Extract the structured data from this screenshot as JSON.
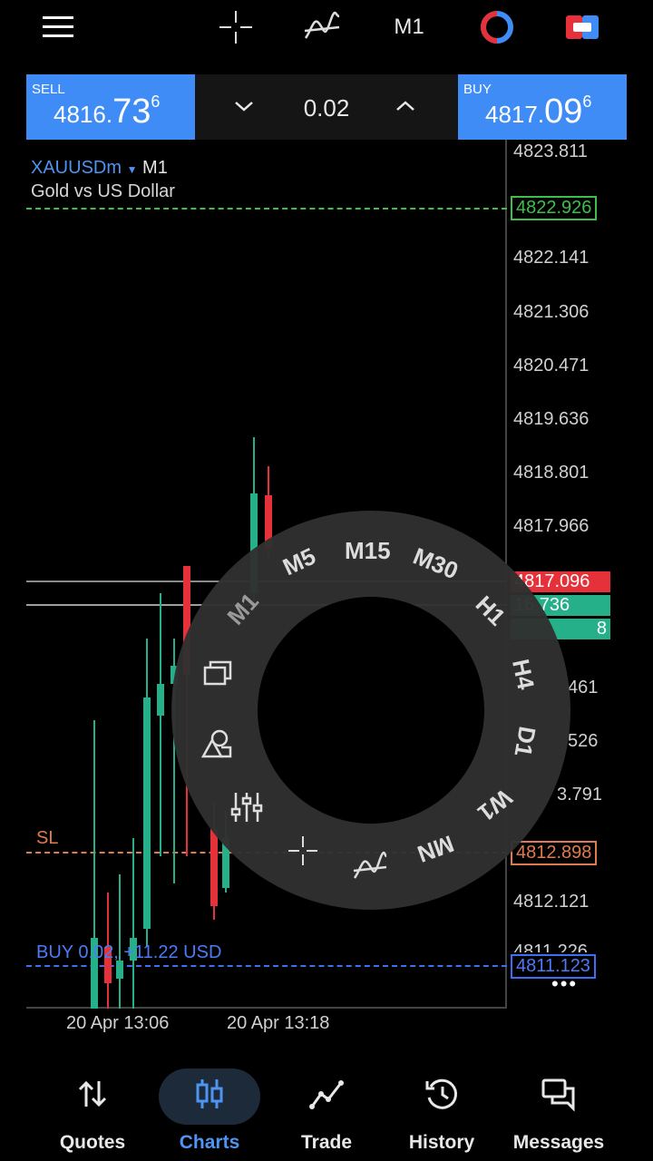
{
  "topbar": {
    "timeframe": "M1"
  },
  "trade": {
    "sell_label": "SELL",
    "sell_price_small": "4816.",
    "sell_price_big": "73",
    "sell_price_sup": "6",
    "buy_label": "BUY",
    "buy_price_small": "4817.",
    "buy_price_big": "09",
    "buy_price_sup": "6",
    "volume": "0.02"
  },
  "chart": {
    "symbol": "XAUUSDm",
    "timeframe": "M1",
    "description": "Gold vs US Dollar",
    "price_scale": [
      "4823.811",
      "4822.141",
      "4821.306",
      "4820.471",
      "4819.636",
      "4818.801",
      "4817.966",
      "461",
      "526",
      "3.791",
      "4812.121",
      "4811.226"
    ],
    "boxed": {
      "green": "4822.926",
      "red": "4817.096",
      "green2": "16.736",
      "green3": "8",
      "sl_price": "4812.898",
      "buy_price": "4811.123"
    },
    "sl_label": "SL",
    "buy_line_label": "BUY 0.02, +11.22 USD",
    "time_labels": [
      "20 Apr 13:06",
      "20 Apr 13:18"
    ],
    "colors": {
      "up": "#26b08a",
      "down": "#e5313a",
      "accent": "#3f8cf6",
      "sl": "#e07b4e"
    }
  },
  "wheel": {
    "timeframes": [
      "M1",
      "M5",
      "M15",
      "M30",
      "H1",
      "H4",
      "D1",
      "W1",
      "MN"
    ]
  },
  "bottom_nav": {
    "items": [
      {
        "label": "Quotes"
      },
      {
        "label": "Charts"
      },
      {
        "label": "Trade"
      },
      {
        "label": "History"
      },
      {
        "label": "Messages"
      }
    ]
  }
}
